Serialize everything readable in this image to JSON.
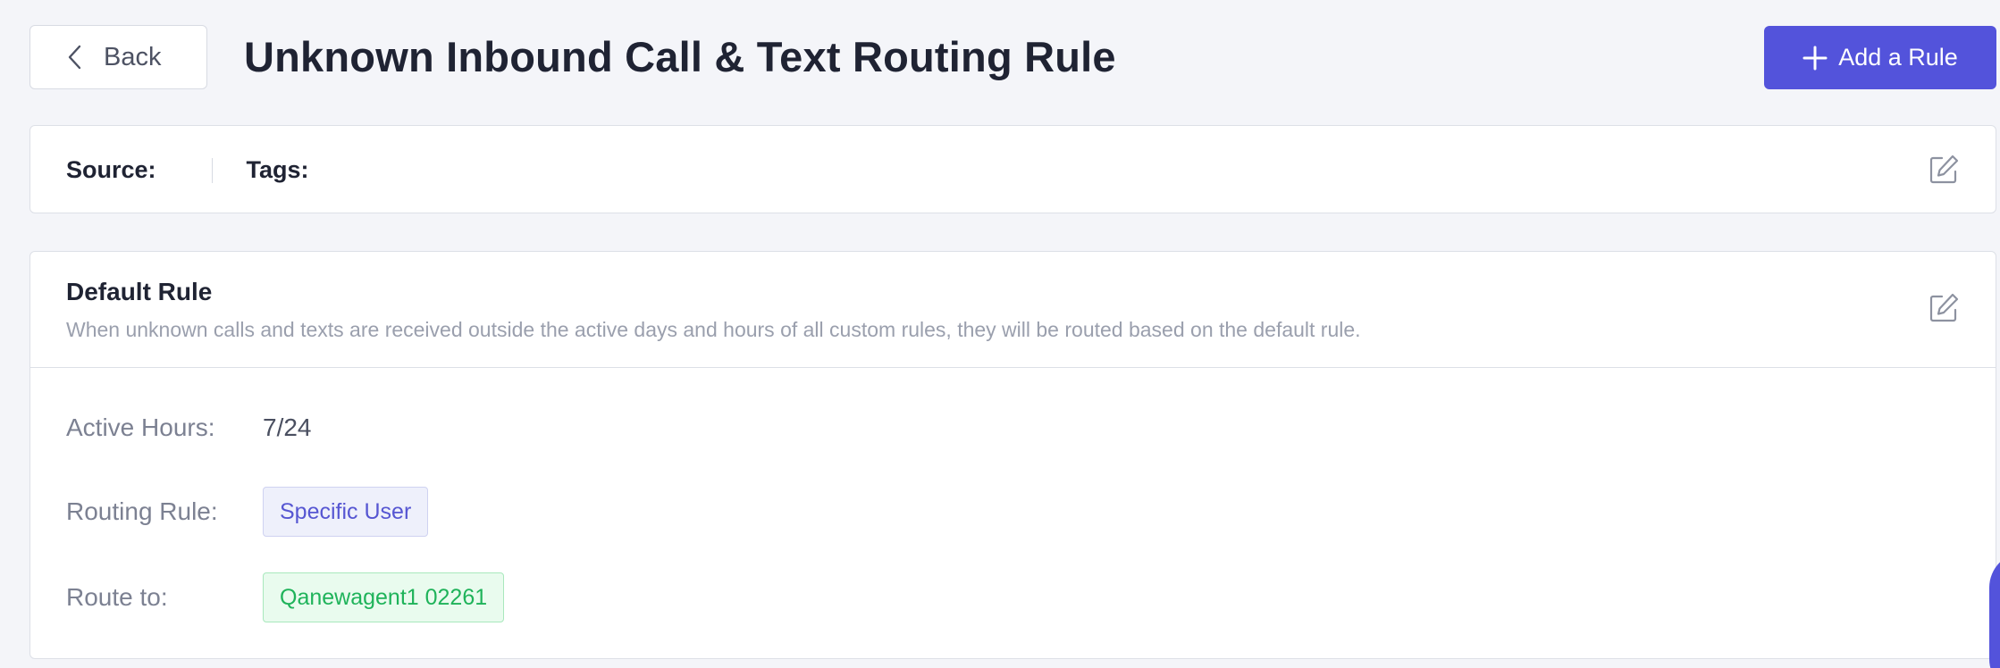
{
  "header": {
    "back_label": "Back",
    "title": "Unknown Inbound Call & Text Routing Rule",
    "add_rule_label": "Add a Rule"
  },
  "source_card": {
    "source_label": "Source:",
    "tags_label": "Tags:"
  },
  "default_rule": {
    "title": "Default Rule",
    "description": "When unknown calls and texts are received outside the active days and hours of all custom rules, they will be routed based on the default rule.",
    "active_hours_label": "Active Hours:",
    "active_hours_value": "7/24",
    "routing_rule_label": "Routing Rule:",
    "routing_rule_value": "Specific User",
    "route_to_label": "Route to:",
    "route_to_value": "Qanewagent1 02261"
  },
  "icons": {
    "back": "chevron-left-icon",
    "add": "plus-icon",
    "edit": "edit-icon"
  },
  "colors": {
    "primary": "#5353db",
    "background": "#f4f5f9",
    "tag_purple_bg": "#eef0fb",
    "tag_green_bg": "#e9fbee",
    "tag_green_text": "#1fb35a"
  }
}
